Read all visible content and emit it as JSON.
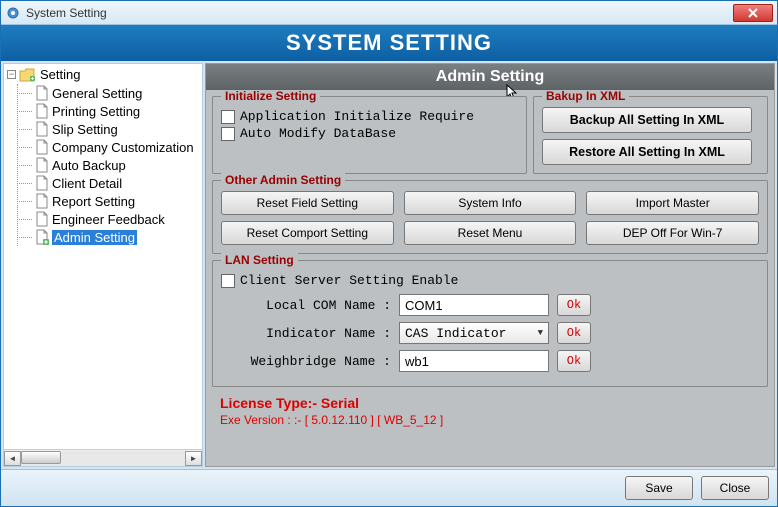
{
  "window_title": "System Setting",
  "header_band": "SYSTEM SETTING",
  "tree": {
    "root": "Setting",
    "items": [
      "General Setting",
      "Printing Setting",
      "Slip Setting",
      "Company Customization",
      "Auto Backup",
      "Client Detail",
      "Report Setting",
      "Engineer Feedback",
      "Admin Setting"
    ],
    "selected_index": 8
  },
  "panel_header": "Admin Setting",
  "initialize": {
    "title": "Initialize Setting",
    "chk1": "Application Initialize Require",
    "chk2": "Auto Modify DataBase"
  },
  "backup": {
    "title": "Bakup In XML",
    "btn_backup": "Backup All Setting In XML",
    "btn_restore": "Restore All Setting In XML"
  },
  "other": {
    "title": "Other Admin Setting",
    "reset_field": "Reset Field Setting",
    "system_info": "System Info",
    "import_master": "Import Master",
    "reset_comport": "Reset Comport Setting",
    "reset_menu": "Reset Menu",
    "dep_off": "DEP Off For Win-7"
  },
  "lan": {
    "title": "LAN Setting",
    "chk_enable": "Client Server Setting Enable",
    "local_com_label": "Local COM Name :",
    "local_com_value": "COM1",
    "indicator_label": "Indicator Name :",
    "indicator_value": "CAS Indicator",
    "weighbridge_label": "Weighbridge Name :",
    "weighbridge_value": "wb1",
    "ok": "Ok"
  },
  "license": "License Type:- Serial",
  "exe_version": "Exe Version : :-  [ 5.0.12.110 ] [ WB_5_12 ]",
  "footer": {
    "save": "Save",
    "close": "Close"
  }
}
